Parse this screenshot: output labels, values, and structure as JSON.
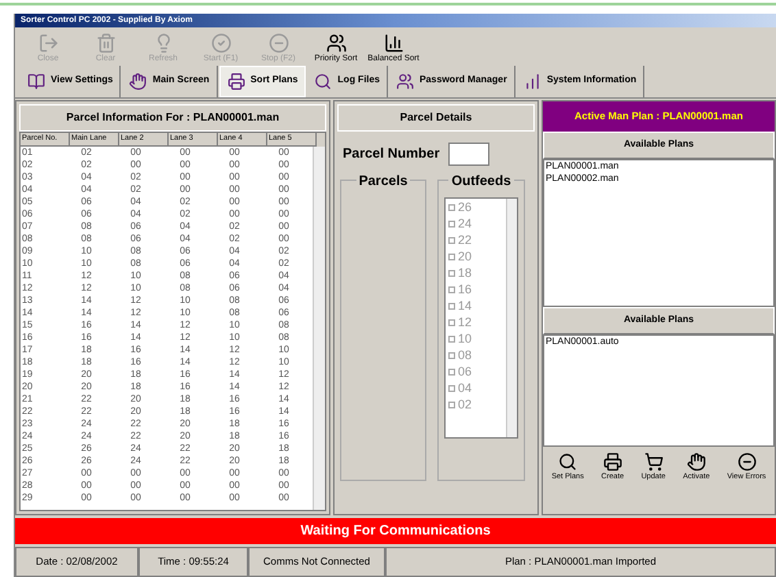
{
  "window": {
    "title": "Sorter Control PC 2002 - Supplied By Axiom"
  },
  "toolbar": [
    {
      "label": "Close",
      "disabled": true
    },
    {
      "label": "Clear",
      "disabled": true
    },
    {
      "label": "Refresh",
      "disabled": true
    },
    {
      "label": "Start (F1)",
      "disabled": true
    },
    {
      "label": "Stop (F2)",
      "disabled": true
    },
    {
      "label": "Priority Sort",
      "disabled": false
    },
    {
      "label": "Balanced Sort",
      "disabled": false
    }
  ],
  "tabs": [
    {
      "label": "View Settings",
      "selected": false
    },
    {
      "label": "Main Screen",
      "selected": false
    },
    {
      "label": "Sort Plans",
      "selected": true
    },
    {
      "label": "Log Files",
      "selected": false
    },
    {
      "label": "Password Manager",
      "selected": false
    },
    {
      "label": "System Information",
      "selected": false
    }
  ],
  "parcel_table": {
    "title": "Parcel Information For : PLAN00001.man",
    "columns": [
      "Parcel No.",
      "Main Lane",
      "Lane 2",
      "Lane 3",
      "Lane 4",
      "Lane 5"
    ],
    "rows": [
      [
        "01",
        "02",
        "00",
        "00",
        "00",
        "00"
      ],
      [
        "02",
        "02",
        "00",
        "00",
        "00",
        "00"
      ],
      [
        "03",
        "04",
        "02",
        "00",
        "00",
        "00"
      ],
      [
        "04",
        "04",
        "02",
        "00",
        "00",
        "00"
      ],
      [
        "05",
        "06",
        "04",
        "02",
        "00",
        "00"
      ],
      [
        "06",
        "06",
        "04",
        "02",
        "00",
        "00"
      ],
      [
        "07",
        "08",
        "06",
        "04",
        "02",
        "00"
      ],
      [
        "08",
        "08",
        "06",
        "04",
        "02",
        "00"
      ],
      [
        "09",
        "10",
        "08",
        "06",
        "04",
        "02"
      ],
      [
        "10",
        "10",
        "08",
        "06",
        "04",
        "02"
      ],
      [
        "11",
        "12",
        "10",
        "08",
        "06",
        "04"
      ],
      [
        "12",
        "12",
        "10",
        "08",
        "06",
        "04"
      ],
      [
        "13",
        "14",
        "12",
        "10",
        "08",
        "06"
      ],
      [
        "14",
        "14",
        "12",
        "10",
        "08",
        "06"
      ],
      [
        "15",
        "16",
        "14",
        "12",
        "10",
        "08"
      ],
      [
        "16",
        "16",
        "14",
        "12",
        "10",
        "08"
      ],
      [
        "17",
        "18",
        "16",
        "14",
        "12",
        "10"
      ],
      [
        "18",
        "18",
        "16",
        "14",
        "12",
        "10"
      ],
      [
        "19",
        "20",
        "18",
        "16",
        "14",
        "12"
      ],
      [
        "20",
        "20",
        "18",
        "16",
        "14",
        "12"
      ],
      [
        "21",
        "22",
        "20",
        "18",
        "16",
        "14"
      ],
      [
        "22",
        "22",
        "20",
        "18",
        "16",
        "14"
      ],
      [
        "23",
        "24",
        "22",
        "20",
        "18",
        "16"
      ],
      [
        "24",
        "24",
        "22",
        "20",
        "18",
        "16"
      ],
      [
        "25",
        "26",
        "24",
        "22",
        "20",
        "18"
      ],
      [
        "26",
        "26",
        "24",
        "22",
        "20",
        "18"
      ],
      [
        "27",
        "00",
        "00",
        "00",
        "00",
        "00"
      ],
      [
        "28",
        "00",
        "00",
        "00",
        "00",
        "00"
      ],
      [
        "29",
        "00",
        "00",
        "00",
        "00",
        "00"
      ]
    ]
  },
  "parcel_details": {
    "title": "Parcel Details",
    "parcel_number_label": "Parcel Number",
    "parcels_label": "Parcels",
    "outfeeds_label": "Outfeeds",
    "outfeeds": [
      {
        "label": "26",
        "checked": false
      },
      {
        "label": "24",
        "checked": false
      },
      {
        "label": "22",
        "checked": false
      },
      {
        "label": "20",
        "checked": false
      },
      {
        "label": "18",
        "checked": false
      },
      {
        "label": "16",
        "checked": false
      },
      {
        "label": "14",
        "checked": false
      },
      {
        "label": "12",
        "checked": false
      },
      {
        "label": "10",
        "checked": false
      },
      {
        "label": "08",
        "checked": false
      },
      {
        "label": "06",
        "checked": false
      },
      {
        "label": "04",
        "checked": false
      },
      {
        "label": "02",
        "checked": false
      }
    ]
  },
  "plans": {
    "active_banner": "Active Man Plan : PLAN00001.man",
    "lists": [
      {
        "title": "Available Plans",
        "items": [
          "PLAN00001.man",
          "PLAN00002.man"
        ]
      },
      {
        "title": "Available Plans",
        "items": [
          "PLAN00001.auto"
        ]
      }
    ],
    "buttons": [
      "Set Plans",
      "Create",
      "Update",
      "Activate",
      "View Errors"
    ]
  },
  "alert_bar": "Waiting For Communications",
  "status_bar": [
    "Date : 02/08/2002",
    "Time : 09:55:24",
    "Comms Not Connected",
    "Plan : PLAN00001.man Imported"
  ]
}
